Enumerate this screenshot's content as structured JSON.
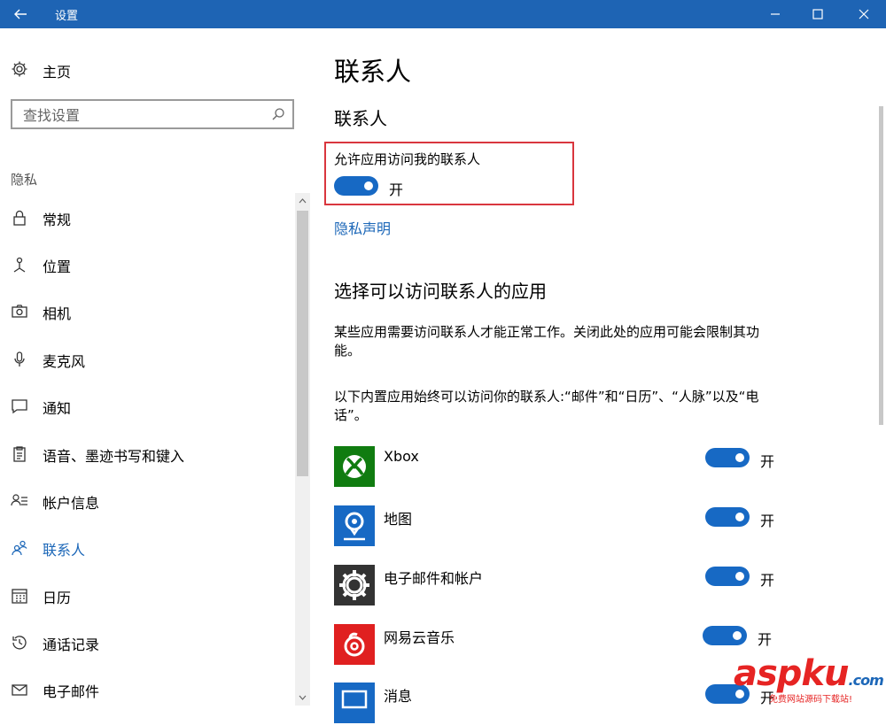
{
  "window": {
    "title": "设置"
  },
  "sidebar": {
    "home_label": "主页",
    "search_placeholder": "查找设置",
    "section_label": "隐私",
    "items": [
      {
        "label": "常规",
        "icon": "lock-icon"
      },
      {
        "label": "位置",
        "icon": "location-icon"
      },
      {
        "label": "相机",
        "icon": "camera-icon"
      },
      {
        "label": "麦克风",
        "icon": "microphone-icon"
      },
      {
        "label": "通知",
        "icon": "notification-icon"
      },
      {
        "label": "语音、墨迹书写和键入",
        "icon": "clipboard-icon"
      },
      {
        "label": "帐户信息",
        "icon": "account-info-icon"
      },
      {
        "label": "联系人",
        "icon": "contacts-icon",
        "active": true
      },
      {
        "label": "日历",
        "icon": "calendar-icon"
      },
      {
        "label": "通话记录",
        "icon": "history-icon"
      },
      {
        "label": "电子邮件",
        "icon": "mail-icon"
      }
    ]
  },
  "main": {
    "page_title": "联系人",
    "sub_title": "联系人",
    "allow_label": "允许应用访问我的联系人",
    "allow_state": "开",
    "privacy_link": "隐私声明",
    "choose_title": "选择可以访问联系人的应用",
    "para1": "某些应用需要访问联系人才能正常工作。关闭此处的应用可能会限制其功能。",
    "para2": "以下内置应用始终可以访问你的联系人:“邮件”和“日历”、“人脉”以及“电话”。",
    "apps": [
      {
        "name": "Xbox",
        "state": "开",
        "color": "#107c10",
        "icon": "xbox-icon"
      },
      {
        "name": "地图",
        "state": "开",
        "color": "#1769c4",
        "icon": "maps-icon"
      },
      {
        "name": "电子邮件和帐户",
        "state": "开",
        "color": "#333333",
        "icon": "gear-icon"
      },
      {
        "name": "网易云音乐",
        "state": "开",
        "color": "#e02020",
        "icon": "netease-music-icon"
      },
      {
        "name": "消息",
        "state": "开",
        "color": "#1769c4",
        "icon": "message-icon"
      }
    ]
  },
  "watermark": {
    "main": "aspku",
    "suffix": ".com",
    "sub": "免费网站源码下载站!"
  },
  "colors": {
    "titlebar": "#1e64b4",
    "accent": "#1769c4",
    "highlight": "#d9363e"
  }
}
